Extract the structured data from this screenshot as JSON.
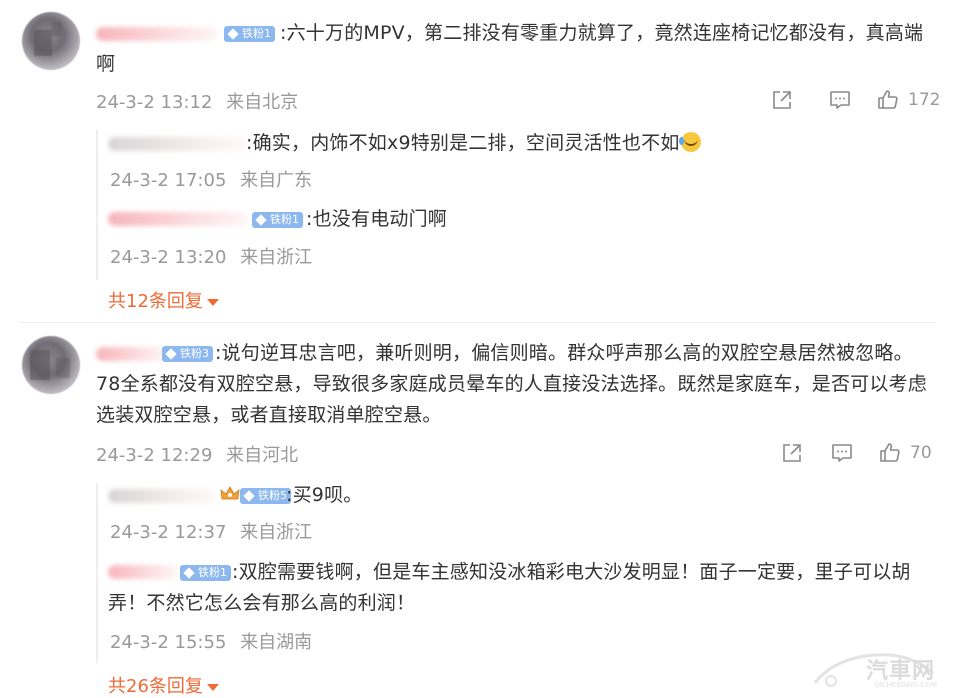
{
  "comments": [
    {
      "badge": "铁粉1",
      "text": ":六十万的MPV，第二排没有零重力就算了，竟然连座椅记忆都没有，真高端啊",
      "date": "24-3-2 13:12",
      "location": "来自北京",
      "likes": "172",
      "replies": [
        {
          "badge": "",
          "text": ":确实，内饰不如x9特别是二排，空间灵活性也不如",
          "emoji": "laugh-cry-emoji",
          "date": "24-3-2 17:05",
          "location": "来自广东"
        },
        {
          "badge": "铁粉1",
          "text": ":也没有电动门啊",
          "date": "24-3-2 13:20",
          "location": "来自浙江"
        }
      ],
      "more_label": "共12条回复"
    },
    {
      "badge": "铁粉3",
      "text": ":说句逆耳忠言吧，兼听则明，偏信则暗。群众呼声那么高的双腔空悬居然被忽略。78全系都没有双腔空悬，导致很多家庭成员晕车的人直接没法选择。既然是家庭车，是否可以考虑选装双腔空悬，或者直接取消单腔空悬。",
      "date": "24-3-2 12:29",
      "location": "来自河北",
      "likes": "70",
      "replies": [
        {
          "badge": "铁粉5",
          "text": ":买9呗。",
          "date": "24-3-2 12:37",
          "location": "来自浙江"
        },
        {
          "badge": "铁粉1",
          "text": ":双腔需要钱啊，但是车主感知没冰箱彩电大沙发明显！面子一定要，里子可以胡弄！不然它怎么会有那么高的利润！",
          "date": "24-3-2 15:55",
          "location": "来自湖南"
        }
      ],
      "more_label": "共26条回复"
    }
  ],
  "watermark": {
    "text": "汽車网",
    "sub": "QICHEWANG.COM"
  },
  "colors": {
    "text": "#333333",
    "meta": "#999999",
    "link": "#ee6a36",
    "badge": "#8db8ef"
  },
  "icons": {
    "share": "share-icon",
    "comment": "comment-icon",
    "like": "thumbs-up-icon"
  }
}
